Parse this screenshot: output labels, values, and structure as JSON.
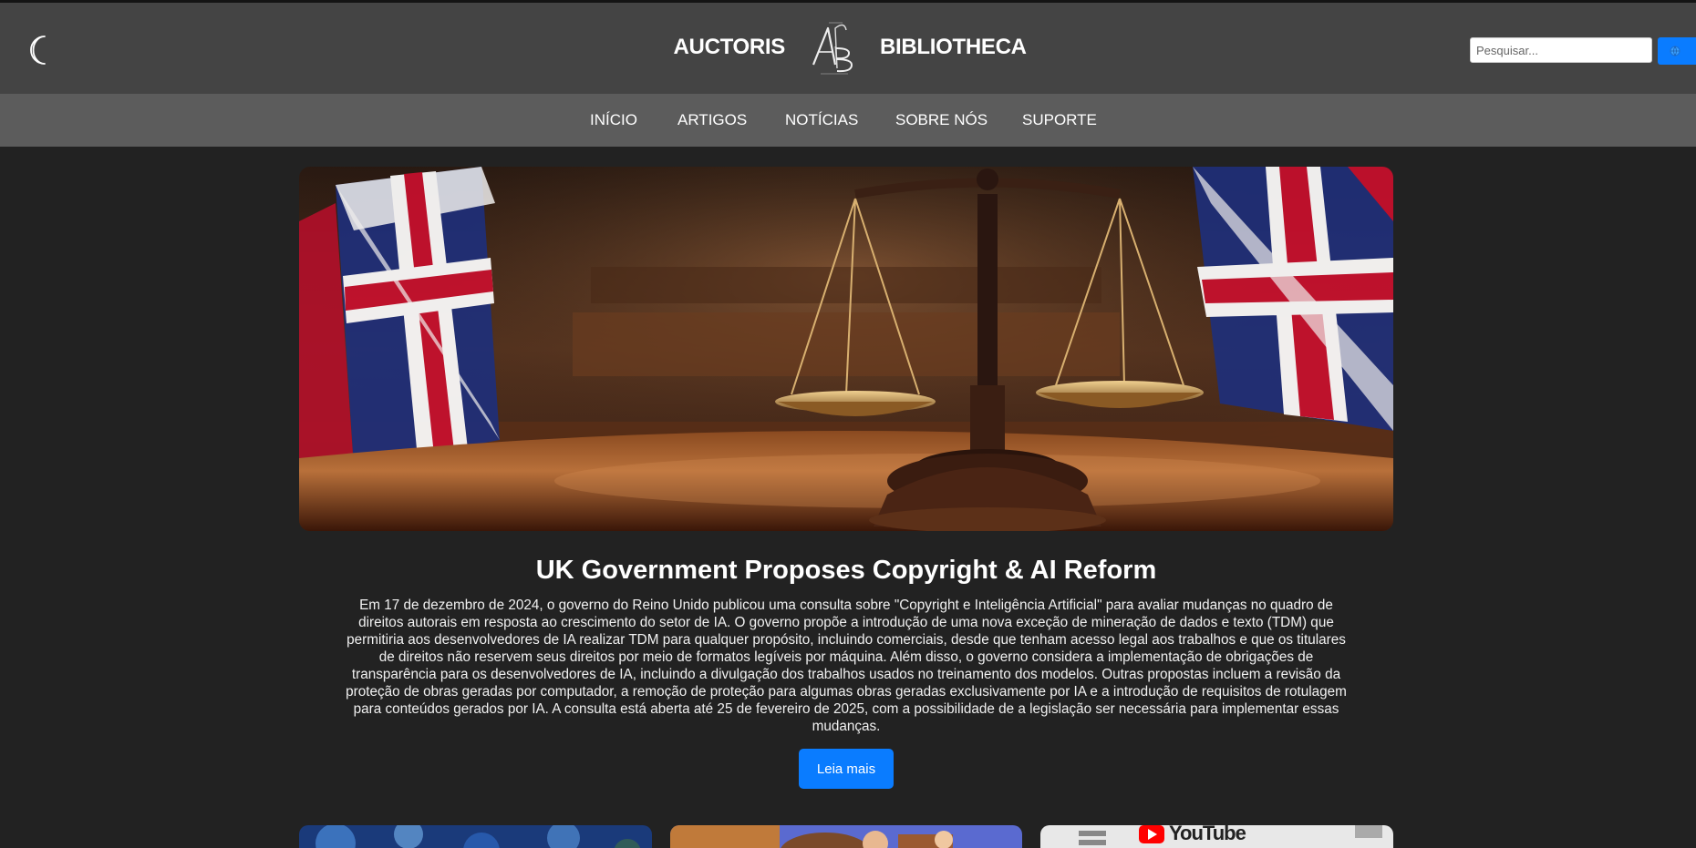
{
  "header": {
    "brand_left": "AUCTORIS",
    "brand_right": "BIBLIOTHECA",
    "logo_text": "AB",
    "search_placeholder": "Pesquisar..."
  },
  "nav": {
    "items": [
      {
        "label": "INÍCIO"
      },
      {
        "label": "ARTIGOS"
      },
      {
        "label": "NOTÍCIAS"
      },
      {
        "label": "SOBRE NÓS"
      },
      {
        "label": "SUPORTE"
      }
    ]
  },
  "featured": {
    "title": "UK Government Proposes Copyright & AI Reform",
    "lines": [
      "Em 17 de dezembro de 2024, o governo do Reino Unido publicou uma consulta sobre \"Copyright e Inteligência Artificial\" para avaliar mudanças no quadro de",
      "direitos autorais em resposta ao crescimento do setor de IA. O governo propõe a introdução de uma nova exceção de mineração de dados e texto (TDM) que",
      "permitiria aos desenvolvedores de IA realizar TDM para qualquer propósito, incluindo comerciais, desde que tenham acesso legal aos trabalhos e que os titulares",
      "de direitos não reservem seus direitos por meio de formatos legíveis por máquina. Além disso, o governo considera a implementação de obrigações de",
      "transparência para os desenvolvedores de IA, incluindo a divulgação dos trabalhos usados no treinamento dos modelos. Outras propostas incluem a revisão da",
      "proteção de obras geradas por computador, a remoção de proteção para algumas obras geradas exclusivamente por IA e a introdução de requisitos de rotulagem",
      "para conteúdos gerados por IA. A consulta está aberta até 25 de fevereiro de 2025, com a possibilidade de a legislação ser necessária para implementar essas",
      "mudanças."
    ],
    "button": "Leia mais"
  },
  "cards": [
    {
      "image": "blue-abstract-image"
    },
    {
      "image": "animated-characters-image"
    },
    {
      "image": "youtube-screenshot-image",
      "visible_text": "YouTube"
    }
  ],
  "icons": {
    "theme": "crescent-moon-icon",
    "search": "globe-search-icon"
  },
  "colors": {
    "page_bg": "#222222",
    "header_bg": "#444444",
    "nav_bg": "#5c5c5c",
    "accent": "#0a7cff"
  }
}
